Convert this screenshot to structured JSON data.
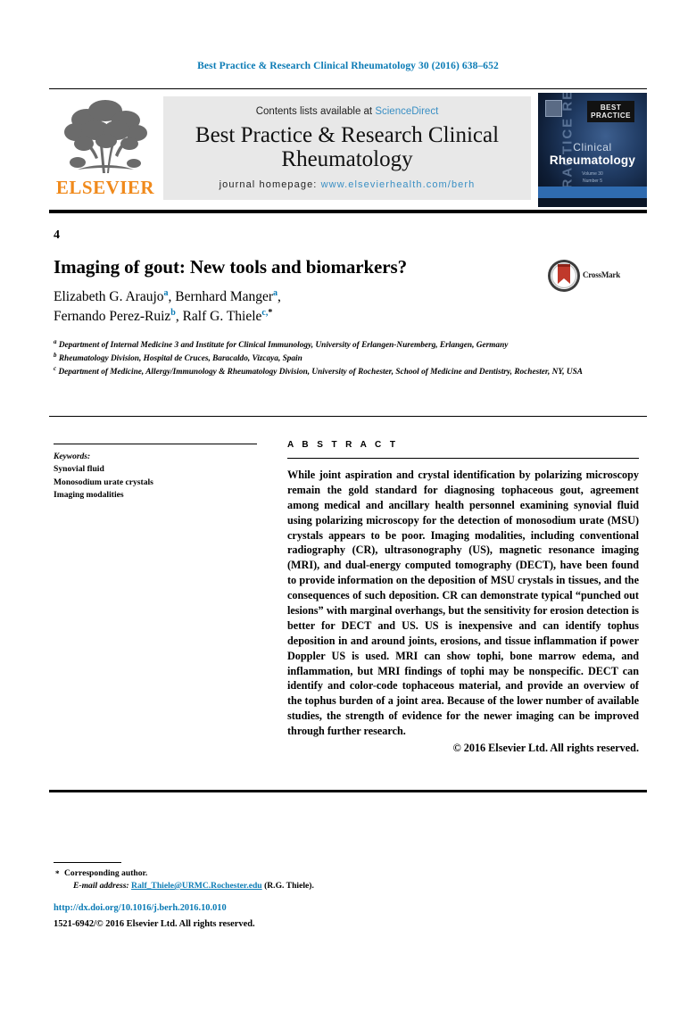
{
  "running_head": "Best Practice & Research Clinical Rheumatology 30 (2016) 638–652",
  "masthead": {
    "contents_prefix": "Contents lists available at",
    "sciencedirect": "ScienceDirect",
    "journal_title": "Best Practice & Research Clinical Rheumatology",
    "homepage_label": "journal homepage:",
    "homepage_url": "www.elsevierhealth.com/berh",
    "publisher_wordmark": "ELSEVIER"
  },
  "cover": {
    "vertical_text": "PRACTICE RESEARCH",
    "best_badge_line1": "BEST",
    "best_badge_line2": "PRACTICE",
    "clinical": "Clinical",
    "rheumatology": "Rheumatology",
    "sub_line1": "Volume 30",
    "sub_line2": "Number 5"
  },
  "article": {
    "section_number": "4",
    "title": "Imaging of gout: New tools and biomarkers?",
    "crossmark_label": "CrossMark",
    "authors": [
      {
        "name": "Elizabeth G. Araujo",
        "sup": "a",
        "sep": ", "
      },
      {
        "name": "Bernhard Manger",
        "sup": "a",
        "sep": ","
      },
      {
        "name": "Fernando Perez-Ruiz",
        "sup": "b",
        "sep": ", "
      },
      {
        "name": "Ralf G. Thiele",
        "sup": "c,",
        "star": "*",
        "sep": ""
      }
    ],
    "affiliations": [
      {
        "marker": "a",
        "text": "Department of Internal Medicine 3 and Institute for Clinical Immunology, University of Erlangen-Nuremberg, Erlangen, Germany"
      },
      {
        "marker": "b",
        "text": "Rheumatology Division, Hospital de Cruces, Baracaldo, Vizcaya, Spain"
      },
      {
        "marker": "c",
        "text": "Department of Medicine, Allergy/Immunology & Rheumatology Division, University of Rochester, School of Medicine and Dentistry, Rochester, NY, USA"
      }
    ]
  },
  "keywords": {
    "heading": "Keywords:",
    "items": [
      "Synovial fluid",
      "Monosodium urate crystals",
      "Imaging modalities"
    ]
  },
  "abstract": {
    "heading": "A B S T R A C T",
    "body": "While joint aspiration and crystal identification by polarizing microscopy remain the gold standard for diagnosing tophaceous gout, agreement among medical and ancillary health personnel examining synovial fluid using polarizing microscopy for the detection of monosodium urate (MSU) crystals appears to be poor. Imaging modalities, including conventional radiography (CR), ultrasonography (US), magnetic resonance imaging (MRI), and dual-energy computed tomography (DECT), have been found to provide information on the deposition of MSU crystals in tissues, and the consequences of such deposition. CR can demonstrate typical “punched out lesions” with marginal overhangs, but the sensitivity for erosion detection is better for DECT and US. US is inexpensive and can identify tophus deposition in and around joints, erosions, and tissue inflammation if power Doppler US is used. MRI can show tophi, bone marrow edema, and inflammation, but MRI findings of tophi may be nonspecific. DECT can identify and color-code tophaceous material, and provide an overview of the tophus burden of a joint area. Because of the lower number of available studies, the strength of evidence for the newer imaging can be improved through further research.",
    "copyright": "© 2016 Elsevier Ltd. All rights reserved."
  },
  "footnotes": {
    "corresponding_marker": "*",
    "corresponding_text": "Corresponding author.",
    "email_label": "E-mail address:",
    "email": "Ralf_Thiele@URMC.Rochester.edu",
    "email_owner": "(R.G. Thiele).",
    "doi": "http://dx.doi.org/10.1016/j.berh.2016.10.010",
    "issn": "1521-6942/© 2016 Elsevier Ltd. All rights reserved."
  },
  "colors": {
    "link_blue": "#0b7bb5",
    "sciencedirect_blue": "#3a8fc4",
    "elsevier_orange": "#f08a1c",
    "cover_navy": "#0b1b33"
  }
}
